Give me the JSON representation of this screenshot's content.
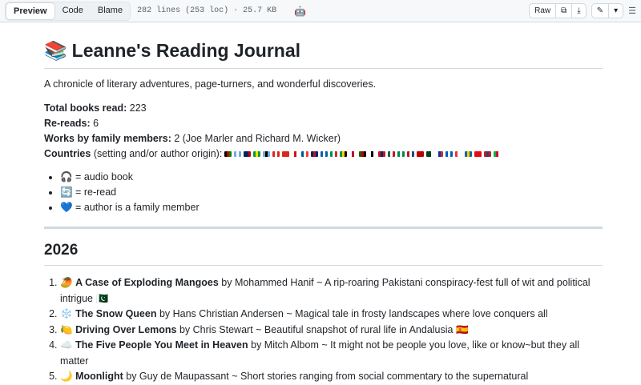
{
  "toolbar": {
    "tabs": [
      "Preview",
      "Code",
      "Blame"
    ],
    "meta": "282 lines (253 loc) · 25.7 KB",
    "copilot_icon": "🤖",
    "raw": "Raw",
    "copy_icon": "⧉",
    "download_icon": "⤓",
    "edit_icon": "✎",
    "dropdown_icon": "▾",
    "outline_icon": "☰"
  },
  "title_emoji": "📚",
  "title": "Leanne's Reading Journal",
  "description": "A chronicle of literary adventures, page-turners, and wonderful discoveries.",
  "stats": [
    {
      "label": "Total books read:",
      "value": " 223"
    },
    {
      "label": "Re-reads:",
      "value": " 6"
    },
    {
      "label": "Works by family members:",
      "value": " 2 (Joe Marler and Richard M. Wicker)"
    }
  ],
  "countries_label": "Countries",
  "countries_rest": " (setting and/or author origin):",
  "flag_colors": [
    [
      "#000",
      "#b00",
      "#080"
    ],
    [
      "#74acdf",
      "#fff",
      "#74acdf"
    ],
    [
      "#012169",
      "#012169",
      "#c00"
    ],
    [
      "#009c3b",
      "#ffdf00",
      "#009c3b"
    ],
    [
      "#75aadb",
      "#000",
      "#75aadb"
    ],
    [
      "#d52b1e",
      "#fff",
      "#d52b1e"
    ],
    [
      "#d52b1e",
      "#d52b1e",
      "#d52b1e"
    ],
    [
      "#fff",
      "#ce1124",
      "#fff"
    ],
    [
      "#0055a4",
      "#fff",
      "#ef4135"
    ],
    [
      "#012169",
      "#c8102e",
      "#012169"
    ],
    [
      "#0d5eaf",
      "#fff",
      "#0d5eaf"
    ],
    [
      "#009246",
      "#fff",
      "#ce2b37"
    ],
    [
      "#009b3a",
      "#fed100",
      "#000"
    ],
    [
      "#fff",
      "#bc002d",
      "#fff"
    ],
    [
      "#006600",
      "#bb0000",
      "#000"
    ],
    [
      "#fff",
      "#000",
      "#fff"
    ],
    [
      "#ce1126",
      "#002868",
      "#ce1126"
    ],
    [
      "#006847",
      "#fff",
      "#ce1126"
    ],
    [
      "#008751",
      "#fff",
      "#008751"
    ],
    [
      "#ae1c28",
      "#fff",
      "#21468b"
    ],
    [
      "#b00",
      "#b00",
      "#b00"
    ],
    [
      "#01411c",
      "#01411c",
      "#fff"
    ],
    [
      "#fff",
      "#0039a6",
      "#d52b1e"
    ],
    [
      "#005eb8",
      "#fff",
      "#005eb8"
    ],
    [
      "#ef3340",
      "#fff",
      "#fff"
    ],
    [
      "#006aa7",
      "#fecc00",
      "#006aa7"
    ],
    [
      "#e30a17",
      "#e30a17",
      "#e30a17"
    ],
    [
      "#b22234",
      "#3c3b6e",
      "#b22234"
    ],
    [
      "#00b140",
      "#c8102e",
      "#fff"
    ]
  ],
  "legend": [
    {
      "emoji": "🎧",
      "text": " = audio book"
    },
    {
      "emoji": "🔄",
      "text": " = re-read"
    },
    {
      "emoji": "💙",
      "text": " = author is a family member"
    }
  ],
  "year": "2026",
  "books": [
    {
      "emoji": "🥭",
      "title": "A Case of Exploding Mangoes",
      "rest": " by Mohammed Hanif ~ A rip-roaring Pakistani conspiracy-fest full of wit and political intrigue ",
      "flag": "🇵🇰"
    },
    {
      "emoji": "❄️",
      "title": "The Snow Queen",
      "rest": " by Hans Christian Andersen ~ Magical tale in frosty landscapes where love conquers all",
      "flag": ""
    },
    {
      "emoji": "🍋",
      "title": "Driving Over Lemons",
      "rest": " by Chris Stewart ~ Beautiful snapshot of rural life in Andalusia ",
      "flag": "🇪🇸"
    },
    {
      "emoji": "☁️",
      "title": "The Five People You Meet in Heaven",
      "rest": " by Mitch Albom ~ It might not be people you love, like or know~but they all matter",
      "flag": ""
    },
    {
      "emoji": "🌙",
      "title": "Moonlight",
      "rest": " by Guy de Maupassant ~ Short stories ranging from social commentary to the supernatural",
      "flag": ""
    }
  ]
}
